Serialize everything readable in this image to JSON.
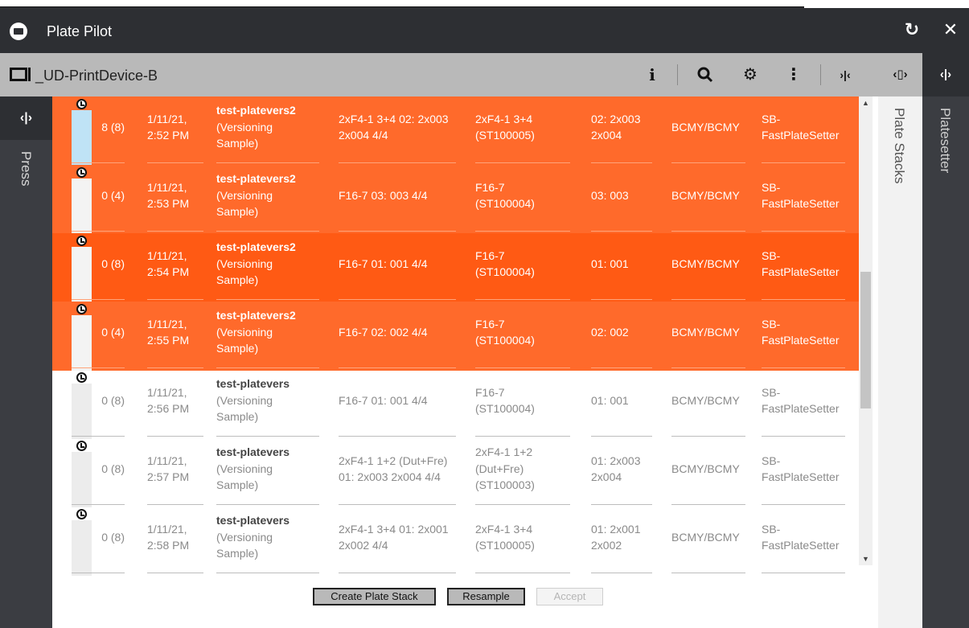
{
  "window": {
    "title": "Plate Pilot"
  },
  "device": {
    "name": "_UD-PrintDevice-B"
  },
  "toolbar": {
    "info": "i",
    "search": "⌕",
    "settings": "⚙",
    "more": "⋮",
    "collapse": "›|‹"
  },
  "tabs": {
    "press": {
      "label": "Press",
      "handle": "‹|›"
    },
    "plate_stacks": {
      "label": "Plate Stacks",
      "handle": "‹▯›"
    },
    "platesetter": {
      "label": "Platesetter",
      "handle": "‹|›"
    }
  },
  "rows": [
    {
      "count": "8 (8)",
      "date": "1/11/21,",
      "time": "2:52 PM",
      "job": "test-platevers2",
      "job_sub1": "(Versioning",
      "job_sub2": "Sample)",
      "desc1": "2xF4-1 3+4 02: 2x003",
      "desc2": "2x004 4/4",
      "desc3": "",
      "lay1": "2xF4-1 3+4",
      "lay2": "(ST100005)",
      "lay3": "",
      "sig1": "02: 2x003",
      "sig2": "2x004",
      "colors": "BCMY/BCMY",
      "dev1": "SB-",
      "dev2": "FastPlateSetter",
      "selected": true
    },
    {
      "count": "0 (4)",
      "date": "1/11/21,",
      "time": "2:53 PM",
      "job": "test-platevers2",
      "job_sub1": "(Versioning",
      "job_sub2": "Sample)",
      "desc1": "F16-7 03: 003 4/4",
      "desc2": "",
      "desc3": "",
      "lay1": "F16-7",
      "lay2": "(ST100004)",
      "lay3": "",
      "sig1": "03: 003",
      "sig2": "",
      "colors": "BCMY/BCMY",
      "dev1": "SB-",
      "dev2": "FastPlateSetter",
      "selected": true
    },
    {
      "count": "0 (8)",
      "date": "1/11/21,",
      "time": "2:54 PM",
      "job": "test-platevers2",
      "job_sub1": "(Versioning",
      "job_sub2": "Sample)",
      "desc1": "F16-7 01: 001 4/4",
      "desc2": "",
      "desc3": "",
      "lay1": "F16-7",
      "lay2": "(ST100004)",
      "lay3": "",
      "sig1": "01: 001",
      "sig2": "",
      "colors": "BCMY/BCMY",
      "dev1": "SB-",
      "dev2": "FastPlateSetter",
      "selected": true
    },
    {
      "count": "0 (4)",
      "date": "1/11/21,",
      "time": "2:55 PM",
      "job": "test-platevers2",
      "job_sub1": "(Versioning",
      "job_sub2": "Sample)",
      "desc1": "F16-7 02: 002 4/4",
      "desc2": "",
      "desc3": "",
      "lay1": "F16-7",
      "lay2": "(ST100004)",
      "lay3": "",
      "sig1": "02: 002",
      "sig2": "",
      "colors": "BCMY/BCMY",
      "dev1": "SB-",
      "dev2": "FastPlateSetter",
      "selected": true
    },
    {
      "count": "0 (8)",
      "date": "1/11/21,",
      "time": "2:56 PM",
      "job": "test-platevers",
      "job_sub1": "(Versioning",
      "job_sub2": "Sample)",
      "desc1": "F16-7 01: 001 4/4",
      "desc2": "",
      "desc3": "",
      "lay1": "F16-7",
      "lay2": "(ST100004)",
      "lay3": "",
      "sig1": "01: 001",
      "sig2": "",
      "colors": "BCMY/BCMY",
      "dev1": "SB-",
      "dev2": "FastPlateSetter",
      "selected": false
    },
    {
      "count": "0 (8)",
      "date": "1/11/21,",
      "time": "2:57 PM",
      "job": "test-platevers",
      "job_sub1": "(Versioning",
      "job_sub2": "Sample)",
      "desc1": "2xF4-1 1+2 (Dut+Fre)",
      "desc2": "01: 2x003 2x004 4/4",
      "desc3": "",
      "lay1": "2xF4-1 1+2",
      "lay2": "(Dut+Fre)",
      "lay3": "(ST100003)",
      "sig1": "01: 2x003",
      "sig2": "2x004",
      "colors": "BCMY/BCMY",
      "dev1": "SB-",
      "dev2": "FastPlateSetter",
      "selected": false
    },
    {
      "count": "0 (8)",
      "date": "1/11/21,",
      "time": "2:58 PM",
      "job": "test-platevers",
      "job_sub1": "(Versioning",
      "job_sub2": "Sample)",
      "desc1": "2xF4-1 3+4 01: 2x001",
      "desc2": "2x002 4/4",
      "desc3": "",
      "lay1": "2xF4-1 3+4",
      "lay2": "(ST100005)",
      "lay3": "",
      "sig1": "01: 2x001",
      "sig2": "2x002",
      "colors": "BCMY/BCMY",
      "dev1": "SB-",
      "dev2": "FastPlateSetter",
      "selected": false
    }
  ],
  "actions": {
    "create": "Create Plate Stack",
    "resample": "Resample",
    "accept": "Accept"
  },
  "colors": {
    "selected_row": "#ff6a2b",
    "focused_row": "#ff5a14",
    "titlebar": "#2d2f33",
    "header": "#b9b9b9"
  }
}
